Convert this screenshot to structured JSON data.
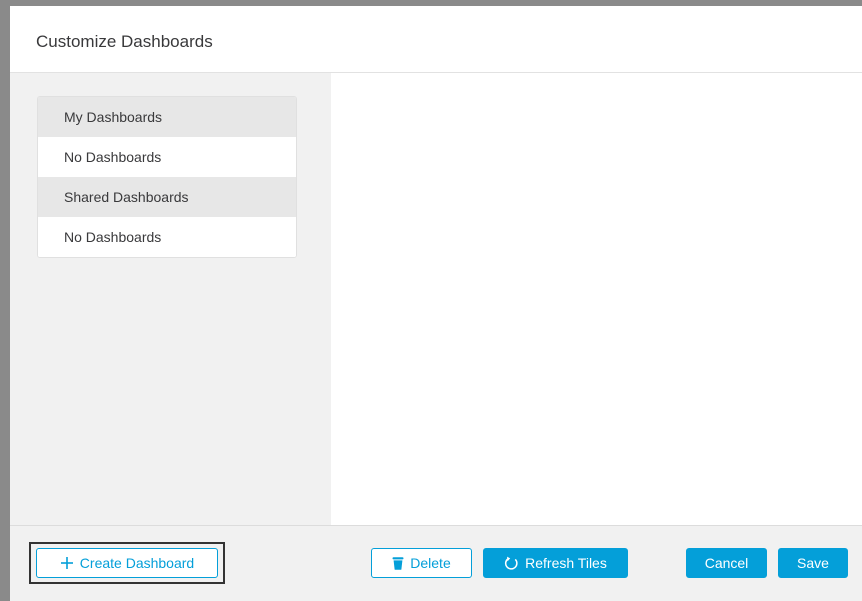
{
  "modal": {
    "title": "Customize Dashboards"
  },
  "sidebar": {
    "sections": [
      {
        "header": "My Dashboards",
        "empty_text": "No Dashboards"
      },
      {
        "header": "Shared Dashboards",
        "empty_text": "No Dashboards"
      }
    ]
  },
  "footer": {
    "create_label": "Create Dashboard",
    "delete_label": "Delete",
    "refresh_label": "Refresh Tiles",
    "cancel_label": "Cancel",
    "save_label": "Save"
  },
  "icons": {
    "create": "plus-icon",
    "delete": "trash-icon",
    "refresh": "refresh-icon"
  },
  "colors": {
    "accent": "#049fd9",
    "pane_bg": "#f1f1f1",
    "section_header_bg": "#e7e7e7",
    "text": "#39393b"
  }
}
